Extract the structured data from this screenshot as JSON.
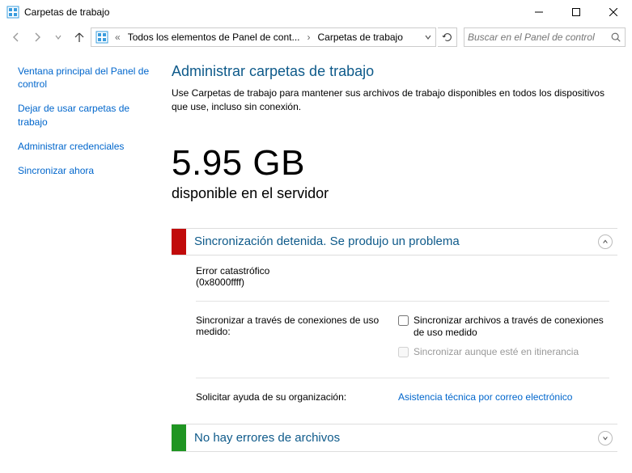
{
  "window": {
    "title": "Carpetas de trabajo"
  },
  "breadcrumb": {
    "root_label": "Todos los elementos de Panel de cont...",
    "current": "Carpetas de trabajo"
  },
  "search": {
    "placeholder": "Buscar en el Panel de control"
  },
  "sidebar": {
    "items": [
      {
        "label": "Ventana principal del Panel de control"
      },
      {
        "label": "Dejar de usar carpetas de trabajo"
      },
      {
        "label": "Administrar credenciales"
      },
      {
        "label": "Sincronizar ahora"
      }
    ]
  },
  "main": {
    "title": "Administrar carpetas de trabajo",
    "desc": "Use Carpetas de trabajo para mantener sus archivos de trabajo disponibles en todos los dispositivos que use, incluso sin conexión.",
    "available_value": "5.95 GB",
    "available_label": "disponible en el servidor"
  },
  "panel1": {
    "title": "Sincronización detenida. Se produjo un problema",
    "error_title": "Error catastrófico",
    "error_code": "(0x8000ffff)",
    "metered_label": "Sincronizar a través de conexiones de uso medido:",
    "cb1_label": "Sincronizar archivos a través de conexiones de uso medido",
    "cb2_label": "Sincronizar aunque esté en itinerancia",
    "help_label": "Solicitar ayuda de su organización:",
    "help_link": "Asistencia técnica por correo electrónico"
  },
  "panel2": {
    "title": "No hay errores de archivos"
  }
}
